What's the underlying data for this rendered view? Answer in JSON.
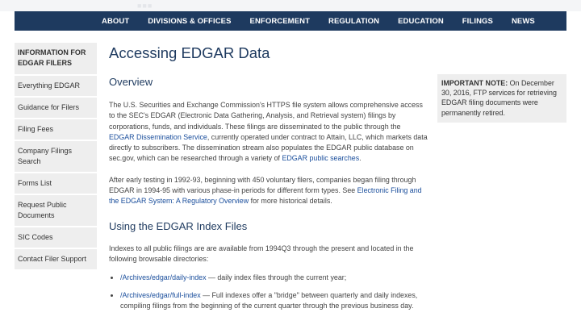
{
  "nav": {
    "items": [
      "ABOUT",
      "DIVISIONS & OFFICES",
      "ENFORCEMENT",
      "REGULATION",
      "EDUCATION",
      "FILINGS",
      "NEWS"
    ]
  },
  "sidebar": {
    "title": "INFORMATION FOR EDGAR FILERS",
    "items": [
      "Everything EDGAR",
      "Guidance for Filers",
      "Filing Fees",
      "Company Filings Search",
      "Forms List",
      "Request Public Documents",
      "SIC Codes",
      "Contact Filer Support"
    ]
  },
  "main": {
    "title": "Accessing EDGAR Data",
    "overview_heading": "Overview",
    "para1": {
      "a": "The U.S. Securities and Exchange Commission's HTTPS file system allows comprehensive access to the SEC's EDGAR (Electronic Data Gathering, Analysis, and Retrieval system) filings by corporations, funds, and individuals. These filings are disseminated to the public through the ",
      "link1": "EDGAR Dissemination Service",
      "b": ", currently operated under contract to Attain, LLC, which markets data directly to subscribers. The dissemination stream also populates the EDGAR public database on sec.gov, which can be researched through a variety of ",
      "link2": "EDGAR public searches",
      "c": "."
    },
    "para2": {
      "a": "After early testing in 1992-93, beginning with 450 voluntary filers, companies began filing through EDGAR in 1994-95 with various phase-in periods for different form types. See ",
      "link": "Electronic Filing and the EDGAR System: A Regulatory Overview",
      "b": " for more historical details."
    },
    "index_heading": "Using the EDGAR Index Files",
    "para3": "Indexes to all public filings are are available from 1994Q3 through the present and located in the following browsable directories:",
    "list": [
      {
        "link": "/Archives/edgar/daily-index",
        "text": " — daily index files through the current year;"
      },
      {
        "link": "/Archives/edgar/full-index",
        "text": " — Full indexes offer a \"bridge\" between quarterly and daily indexes, compiling filings from the beginning of the current quarter through the previous business day."
      }
    ]
  },
  "note": {
    "label": "IMPORTANT NOTE:",
    "text": " On December 30, 2016, FTP services for retrieving EDGAR filing documents were permanently retired."
  }
}
